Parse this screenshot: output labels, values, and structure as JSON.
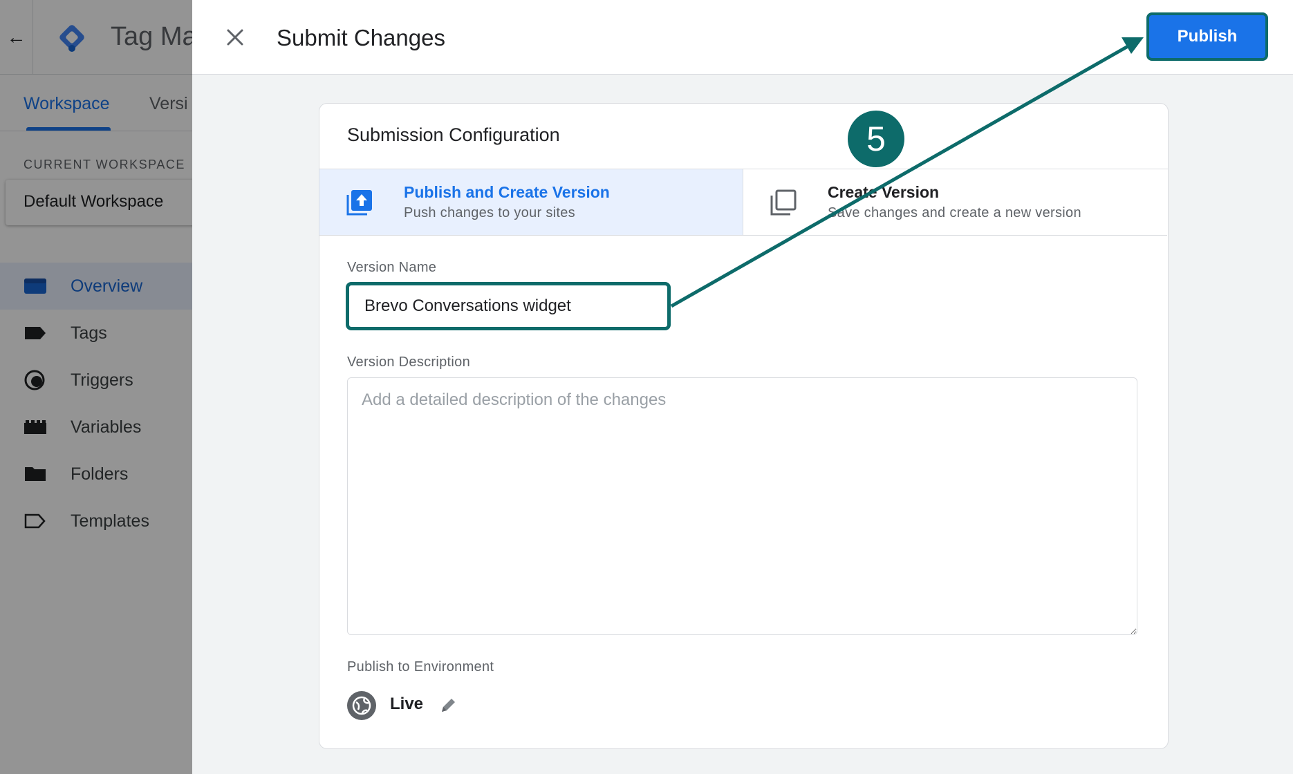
{
  "background": {
    "back_icon": "arrow-left-icon",
    "logo_icon": "tag-manager-logo",
    "app_title": "Tag Ma",
    "tabs": [
      {
        "label": "Workspace",
        "active": true
      },
      {
        "label": "Versi",
        "active": false
      }
    ],
    "current_workspace_label": "CURRENT WORKSPACE",
    "workspace_name": "Default Workspace",
    "nav": [
      {
        "label": "Overview",
        "icon": "overview-icon",
        "active": true
      },
      {
        "label": "Tags",
        "icon": "tag-icon",
        "active": false
      },
      {
        "label": "Triggers",
        "icon": "trigger-icon",
        "active": false
      },
      {
        "label": "Variables",
        "icon": "variables-icon",
        "active": false
      },
      {
        "label": "Folders",
        "icon": "folder-icon",
        "active": false
      },
      {
        "label": "Templates",
        "icon": "template-icon",
        "active": false
      }
    ]
  },
  "dialog": {
    "close_icon": "close-icon",
    "title": "Submit Changes",
    "publish_label": "Publish",
    "card_title": "Submission Configuration",
    "options": [
      {
        "title": "Publish and Create Version",
        "subtitle": "Push changes to your sites",
        "icon": "publish-icon",
        "selected": true
      },
      {
        "title": "Create Version",
        "subtitle": "Save changes and create a new version",
        "icon": "copy-icon",
        "selected": false
      }
    ],
    "version_name_label": "Version Name",
    "version_name_value": "Brevo Conversations widget",
    "version_description_label": "Version Description",
    "version_description_placeholder": "Add a detailed description of the changes",
    "version_description_value": "",
    "environment_label": "Publish to Environment",
    "environment_name": "Live",
    "environment_icon": "globe-icon",
    "edit_icon": "pencil-icon"
  },
  "annotation": {
    "step_number": "5",
    "color": "#0d6b6a"
  },
  "colors": {
    "accent": "#1a73e8",
    "selected_bg": "#e8f0fe",
    "annotation": "#0d6b6a",
    "panel_bg": "#f1f3f4"
  }
}
